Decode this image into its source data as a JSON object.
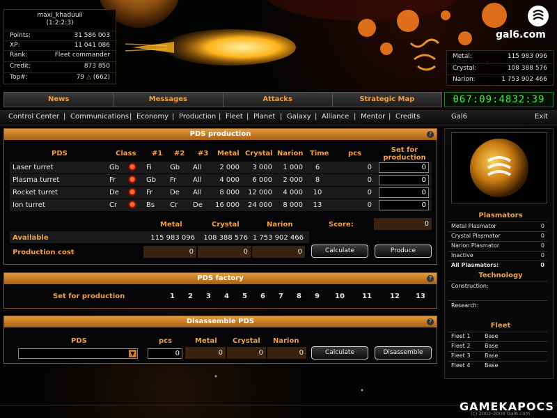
{
  "player": {
    "name": "maxi_khaduuii",
    "coords": "(1:2:2:3)",
    "stats": [
      {
        "label": "Points:",
        "value": "31 586 003"
      },
      {
        "label": "XP:",
        "value": "11 041 086"
      },
      {
        "label": "Rank:",
        "value": "Fleet commander"
      },
      {
        "label": "Credit:",
        "value": "873 850"
      }
    ],
    "top_label": "Top#:",
    "top_value": "79",
    "top_prev": "(662)"
  },
  "brand": {
    "logo_text": "gal6.com"
  },
  "resources": [
    {
      "label": "Metal:",
      "value": "115 983 096"
    },
    {
      "label": "Crystal:",
      "value": "108 388 576"
    },
    {
      "label": "Narion:",
      "value": "1 753 902 466"
    }
  ],
  "top_nav": [
    "News",
    "Messages",
    "Attacks",
    "Strategic Map"
  ],
  "clock": "067:09:4832:39",
  "sub_nav": [
    "Control Center",
    "Communications",
    "Economy",
    "Production",
    "Fleet",
    "Planet",
    "Galaxy",
    "Alliance",
    "Mentor",
    "Credits"
  ],
  "sub_nav_right": {
    "galaxy": "Gal6",
    "exit": "Exit"
  },
  "pds_production": {
    "title": "PDS production",
    "headers": {
      "pds": "PDS",
      "class": "Class",
      "c1": "#1",
      "c2": "#2",
      "c3": "#3",
      "metal": "Metal",
      "crystal": "Crystal",
      "narion": "Narion",
      "time": "Time",
      "pcs": "pcs",
      "set": "Set for production"
    },
    "rows": [
      {
        "name": "Laser turret",
        "class": "Gb",
        "c1": "Fi",
        "c2": "Gb",
        "c3": "All",
        "metal": "2 000",
        "crystal": "3 000",
        "narion": "1 000",
        "time": "6",
        "pcs": "0",
        "set": "0"
      },
      {
        "name": "Plasma turret",
        "class": "Fr",
        "c1": "Gb",
        "c2": "Fr",
        "c3": "All",
        "metal": "4 000",
        "crystal": "6 000",
        "narion": "2 000",
        "time": "8",
        "pcs": "0",
        "set": "0"
      },
      {
        "name": "Rocket turret",
        "class": "De",
        "c1": "Fr",
        "c2": "De",
        "c3": "All",
        "metal": "8 000",
        "crystal": "12 000",
        "narion": "4 000",
        "time": "10",
        "pcs": "0",
        "set": "0"
      },
      {
        "name": "Ion turret",
        "class": "Cr",
        "c1": "Bs",
        "c2": "Cr",
        "c3": "De",
        "metal": "16 000",
        "crystal": "24 000",
        "narion": "8 000",
        "time": "13",
        "pcs": "0",
        "set": "0"
      }
    ],
    "summary_headers": {
      "metal": "Metal",
      "crystal": "Crystal",
      "narion": "Narion",
      "score": "Score:"
    },
    "score": "0",
    "available_label": "Available",
    "available": {
      "metal": "115 983 096",
      "crystal": "108 388 576",
      "narion": "1 753 902 466"
    },
    "cost_label": "Production cost",
    "cost": {
      "metal": "0",
      "crystal": "0",
      "narion": "0"
    },
    "calculate": "Calculate",
    "produce": "Produce"
  },
  "pds_factory": {
    "title": "PDS factory",
    "label": "Set for production",
    "slots": [
      "1",
      "2",
      "3",
      "4",
      "5",
      "6",
      "7",
      "8",
      "9",
      "10",
      "11",
      "12",
      "13"
    ]
  },
  "disassemble": {
    "title": "Disassemble PDS",
    "headers": {
      "pds": "PDS",
      "pcs": "pcs",
      "metal": "Metal",
      "crystal": "Crystal",
      "narion": "Narion"
    },
    "pcs": "0",
    "metal": "0",
    "crystal": "0",
    "narion": "0",
    "calculate": "Calculate",
    "disassemble": "Disassemble"
  },
  "plasmators": {
    "title": "Plasmators",
    "rows": [
      {
        "label": "Metal Plasmator",
        "value": "0"
      },
      {
        "label": "Crystal Plasmator",
        "value": "0"
      },
      {
        "label": "Narion Plasmator",
        "value": "0"
      },
      {
        "label": "Inactive",
        "value": "0"
      },
      {
        "label": "All Plasmators:",
        "value": "0"
      }
    ]
  },
  "technology": {
    "title": "Technology",
    "construction": "Construction:",
    "research": "Research:"
  },
  "fleet": {
    "title": "Fleet",
    "rows": [
      {
        "label": "Fleet 1",
        "value": "Base"
      },
      {
        "label": "Fleet 2",
        "value": "Base"
      },
      {
        "label": "Fleet 3",
        "value": "Base"
      },
      {
        "label": "Fleet 4",
        "value": "Base"
      }
    ]
  },
  "watermark": "GAMEKAPOCS",
  "copyright": "(c) 2002-2008 Gal6.com",
  "colors": {
    "accent": "#f0a040",
    "panel_header": "#d98a2a",
    "clock": "#3af03a"
  }
}
